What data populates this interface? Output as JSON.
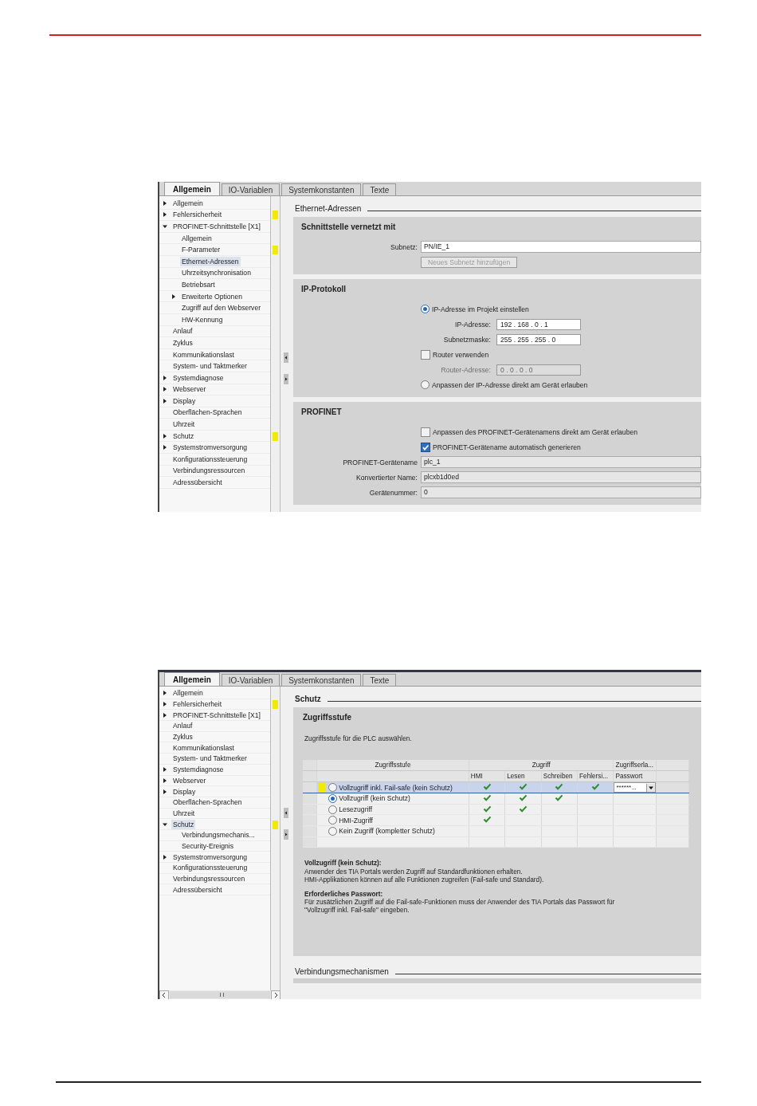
{
  "screen1": {
    "tabs": [
      {
        "label": "Allgemein",
        "selected": true
      },
      {
        "label": "IO-Variablen",
        "selected": false
      },
      {
        "label": "Systemkonstanten",
        "selected": false
      },
      {
        "label": "Texte",
        "selected": false
      }
    ],
    "nav": [
      {
        "label": "Allgemein",
        "kind": "group",
        "expanded": false,
        "selected": false,
        "flag": false
      },
      {
        "label": "Fehlersicherheit",
        "kind": "group",
        "expanded": false,
        "selected": false,
        "flag": true
      },
      {
        "label": "PROFINET-Schnittstelle [X1]",
        "kind": "group",
        "expanded": true,
        "selected": false,
        "flag": false,
        "children": [
          {
            "label": "Allgemein",
            "kind": "page",
            "selected": false,
            "flag": false
          },
          {
            "label": "F-Parameter",
            "kind": "page",
            "selected": false,
            "flag": true
          },
          {
            "label": "Ethernet-Adressen",
            "kind": "page",
            "selected": true,
            "flag": false
          },
          {
            "label": "Uhrzeitsynchronisation",
            "kind": "page",
            "selected": false,
            "flag": false
          },
          {
            "label": "Betriebsart",
            "kind": "page",
            "selected": false,
            "flag": false
          },
          {
            "label": "Erweiterte Optionen",
            "kind": "group",
            "expanded": false,
            "selected": false,
            "flag": false
          },
          {
            "label": "Zugriff auf den Webserver",
            "kind": "page",
            "selected": false,
            "flag": false
          },
          {
            "label": "HW-Kennung",
            "kind": "page",
            "selected": false,
            "flag": false
          }
        ]
      },
      {
        "label": "Anlauf",
        "kind": "page",
        "selected": false,
        "flag": false
      },
      {
        "label": "Zyklus",
        "kind": "page",
        "selected": false,
        "flag": false
      },
      {
        "label": "Kommunikationslast",
        "kind": "page",
        "selected": false,
        "flag": false
      },
      {
        "label": "System- und Taktmerker",
        "kind": "page",
        "selected": false,
        "flag": false
      },
      {
        "label": "Systemdiagnose",
        "kind": "group",
        "expanded": false,
        "selected": false,
        "flag": false
      },
      {
        "label": "Webserver",
        "kind": "group",
        "expanded": false,
        "selected": false,
        "flag": false
      },
      {
        "label": "Display",
        "kind": "group",
        "expanded": false,
        "selected": false,
        "flag": false
      },
      {
        "label": "Oberflächen-Sprachen",
        "kind": "page",
        "selected": false,
        "flag": false
      },
      {
        "label": "Uhrzeit",
        "kind": "page",
        "selected": false,
        "flag": false
      },
      {
        "label": "Schutz",
        "kind": "group",
        "expanded": false,
        "selected": false,
        "flag": true
      },
      {
        "label": "Systemstromversorgung",
        "kind": "group",
        "expanded": false,
        "selected": false,
        "flag": false
      },
      {
        "label": "Konfigurationssteuerung",
        "kind": "page",
        "selected": false,
        "flag": false
      },
      {
        "label": "Verbindungsressourcen",
        "kind": "page",
        "selected": false,
        "flag": false
      },
      {
        "label": "Adressübersicht",
        "kind": "page",
        "selected": false,
        "flag": false
      }
    ],
    "horizontal_scrollbar": false,
    "section_title": "Ethernet-Adressen",
    "panels": [
      {
        "title": "Schnittstelle vernetzt mit",
        "rows": [
          {
            "kind": "field",
            "label": "Subnetz:",
            "value": "PN/IE_1",
            "white": true
          },
          {
            "kind": "button",
            "label": "Neues Subnetz hinzufügen",
            "disabled": true
          }
        ]
      },
      {
        "title": "IP-Protokoll",
        "rows": [
          {
            "kind": "radio",
            "label": "IP-Adresse im Projekt einstellen",
            "selected": true
          },
          {
            "kind": "address",
            "label": "IP-Adresse:",
            "value": "192 . 168 . 0 . 1",
            "disabled": false
          },
          {
            "kind": "address",
            "label": "Subnetzmaske:",
            "value": "255 . 255 . 255 . 0",
            "disabled": false
          },
          {
            "kind": "checkbox",
            "label": "Router verwenden",
            "checked": false
          },
          {
            "kind": "address",
            "label": "Router-Adresse:",
            "value": "0 . 0 . 0 . 0",
            "disabled": true
          },
          {
            "kind": "radio",
            "label": "Anpassen der IP-Adresse direkt am Gerät erlauben",
            "selected": false
          }
        ]
      },
      {
        "title": "PROFINET",
        "rows": [
          {
            "kind": "checkbox",
            "label": "Anpassen des PROFINET-Gerätenamens direkt am Gerät erlauben",
            "checked": false
          },
          {
            "kind": "checkbox",
            "label": "PROFINET-Gerätename automatisch generieren",
            "checked": true
          },
          {
            "kind": "field",
            "label": "PROFINET-Gerätename",
            "value": "plc_1",
            "white": false
          },
          {
            "kind": "field",
            "label": "Konvertierter Name:",
            "value": "plcxb1d0ed",
            "white": false
          },
          {
            "kind": "field",
            "label": "Gerätenummer:",
            "value": "0",
            "white": false
          }
        ]
      }
    ]
  },
  "screen2": {
    "tabs": [
      {
        "label": "Allgemein",
        "selected": true
      },
      {
        "label": "IO-Variablen",
        "selected": false
      },
      {
        "label": "Systemkonstanten",
        "selected": false
      },
      {
        "label": "Texte",
        "selected": false
      }
    ],
    "nav": [
      {
        "label": "Allgemein",
        "kind": "group",
        "expanded": false,
        "selected": false,
        "flag": false
      },
      {
        "label": "Fehlersicherheit",
        "kind": "group",
        "expanded": false,
        "selected": false,
        "flag": true
      },
      {
        "label": "PROFINET-Schnittstelle [X1]",
        "kind": "group",
        "expanded": false,
        "selected": false,
        "flag": false
      },
      {
        "label": "Anlauf",
        "kind": "page",
        "selected": false,
        "flag": false
      },
      {
        "label": "Zyklus",
        "kind": "page",
        "selected": false,
        "flag": false
      },
      {
        "label": "Kommunikationslast",
        "kind": "page",
        "selected": false,
        "flag": false
      },
      {
        "label": "System- und Taktmerker",
        "kind": "page",
        "selected": false,
        "flag": false
      },
      {
        "label": "Systemdiagnose",
        "kind": "group",
        "expanded": false,
        "selected": false,
        "flag": false
      },
      {
        "label": "Webserver",
        "kind": "group",
        "expanded": false,
        "selected": false,
        "flag": false
      },
      {
        "label": "Display",
        "kind": "group",
        "expanded": false,
        "selected": false,
        "flag": false
      },
      {
        "label": "Oberflächen-Sprachen",
        "kind": "page",
        "selected": false,
        "flag": false
      },
      {
        "label": "Uhrzeit",
        "kind": "page",
        "selected": false,
        "flag": false
      },
      {
        "label": "Schutz",
        "kind": "group",
        "expanded": true,
        "selected": true,
        "flag": true,
        "children": [
          {
            "label": "Verbindungsmechanis...",
            "kind": "page",
            "selected": false,
            "flag": false
          },
          {
            "label": "Security-Ereignis",
            "kind": "page",
            "selected": false,
            "flag": false
          }
        ]
      },
      {
        "label": "Systemstromversorgung",
        "kind": "group",
        "expanded": false,
        "selected": false,
        "flag": false
      },
      {
        "label": "Konfigurationssteuerung",
        "kind": "page",
        "selected": false,
        "flag": false
      },
      {
        "label": "Verbindungsressourcen",
        "kind": "page",
        "selected": false,
        "flag": false
      },
      {
        "label": "Adressübersicht",
        "kind": "page",
        "selected": false,
        "flag": false
      }
    ],
    "horizontal_scrollbar": true,
    "section_title": "Schutz",
    "panel_title": "Zugriffsstufe",
    "intro": "Zugriffsstufe für die PLC auswählen.",
    "table": {
      "group_headers": [
        "Zugriffsstufe",
        "Zugriff",
        "Zugriffserla..."
      ],
      "columns": [
        "HMI",
        "Lesen",
        "Schreiben",
        "Fehlersi...",
        "Passwort"
      ],
      "rows": [
        {
          "label": "Vollzugriff inkl. Fail-safe (kein Schutz)",
          "selected": false,
          "focused": true,
          "flag": true,
          "access": [
            true,
            true,
            true,
            true
          ],
          "password": "******..."
        },
        {
          "label": "Vollzugriff (kein Schutz)",
          "selected": true,
          "focused": false,
          "flag": false,
          "access": [
            true,
            true,
            true,
            false
          ]
        },
        {
          "label": "Lesezugriff",
          "selected": false,
          "focused": false,
          "flag": false,
          "access": [
            true,
            true,
            false,
            false
          ]
        },
        {
          "label": "HMI-Zugriff",
          "selected": false,
          "focused": false,
          "flag": false,
          "access": [
            true,
            false,
            false,
            false
          ]
        },
        {
          "label": "Kein Zugriff (kompletter Schutz)",
          "selected": false,
          "focused": false,
          "flag": false,
          "access": [
            false,
            false,
            false,
            false
          ]
        }
      ]
    },
    "description": [
      {
        "heading": "Vollzugriff (kein Schutz):",
        "lines": [
          "Anwender des TIA Portals werden Zugriff auf Standardfunktionen erhalten.",
          "HMI-Applikationen können auf alle Funktionen zugreifen (Fail-safe und Standard)."
        ]
      },
      {
        "heading": "Erforderliches Passwort:",
        "lines": [
          "Für zusätzlichen Zugriff auf die Fail-safe-Funktionen muss der Anwender des TIA Portals das Passwort für",
          "\"Vollzugriff inkl. Fail-safe\" eingeben."
        ]
      }
    ],
    "next_section_title": "Verbindungsmechanismen"
  }
}
